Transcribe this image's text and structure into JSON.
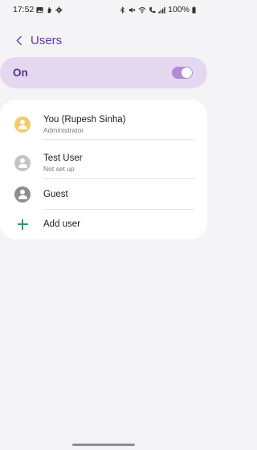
{
  "status_bar": {
    "time": "17:52",
    "left_icons": [
      "gallery-icon",
      "hand-icon",
      "settings-icon"
    ],
    "right_icons": [
      "bluetooth-icon",
      "mute-icon",
      "wifi-icon",
      "call-icon",
      "signal-icon"
    ],
    "battery": "100%"
  },
  "header": {
    "title": "Users"
  },
  "master_toggle": {
    "label": "On",
    "enabled": true
  },
  "users": [
    {
      "name": "You (Rupesh Sinha)",
      "subtitle": "Administrator",
      "avatar_color": "#f4c96b"
    },
    {
      "name": "Test User",
      "subtitle": "Not set up",
      "avatar_color": "#c4c4c6"
    },
    {
      "name": "Guest",
      "subtitle": "",
      "avatar_color": "#8e8e92"
    }
  ],
  "add_user": {
    "label": "Add user"
  },
  "colors": {
    "accent": "#6237a0",
    "toggle_bg": "#e3d8f0",
    "switch_on": "#b28ad8",
    "add_icon": "#2e9b63"
  }
}
